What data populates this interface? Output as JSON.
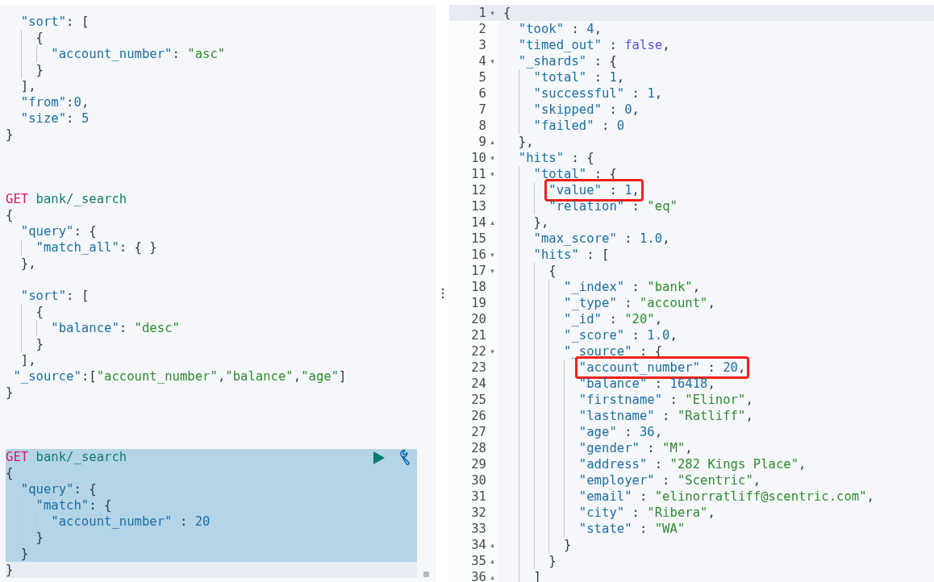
{
  "request_editor": {
    "blocks": [
      {
        "selected": false,
        "lines": [
          {
            "active": false,
            "tokens": [
              {
                "kind": "key",
                "text": "  \"sort\""
              },
              {
                "kind": "punct",
                "text": ": ["
              }
            ]
          },
          {
            "active": false,
            "tokens": [
              {
                "kind": "punct",
                "text": "    {"
              }
            ]
          },
          {
            "active": false,
            "tokens": [
              {
                "kind": "key",
                "text": "      \"account_number\""
              },
              {
                "kind": "punct",
                "text": ": "
              },
              {
                "kind": "string",
                "text": "\"asc\""
              }
            ]
          },
          {
            "active": false,
            "tokens": [
              {
                "kind": "punct",
                "text": "    }"
              }
            ]
          },
          {
            "active": false,
            "tokens": [
              {
                "kind": "punct",
                "text": "  ],"
              }
            ]
          },
          {
            "active": false,
            "tokens": [
              {
                "kind": "key",
                "text": "  \"from\""
              },
              {
                "kind": "punct",
                "text": ":"
              },
              {
                "kind": "number",
                "text": "0"
              },
              {
                "kind": "punct",
                "text": ","
              }
            ]
          },
          {
            "active": false,
            "tokens": [
              {
                "kind": "key",
                "text": "  \"size\""
              },
              {
                "kind": "punct",
                "text": ": "
              },
              {
                "kind": "number",
                "text": "5"
              }
            ]
          },
          {
            "active": false,
            "tokens": [
              {
                "kind": "punct",
                "text": "}"
              }
            ]
          }
        ]
      },
      {
        "selected": false,
        "lines": [
          {
            "active": false,
            "tokens": [
              {
                "kind": "method",
                "text": "GET"
              },
              {
                "kind": "url",
                "text": " bank/_search"
              }
            ]
          },
          {
            "active": false,
            "tokens": [
              {
                "kind": "punct",
                "text": "{"
              }
            ]
          },
          {
            "active": false,
            "tokens": [
              {
                "kind": "key",
                "text": "  \"query\""
              },
              {
                "kind": "punct",
                "text": ": {"
              }
            ]
          },
          {
            "active": false,
            "tokens": [
              {
                "kind": "key",
                "text": "    \"match_all\""
              },
              {
                "kind": "punct",
                "text": ": { }"
              }
            ]
          },
          {
            "active": false,
            "tokens": [
              {
                "kind": "punct",
                "text": "  },"
              }
            ]
          },
          {
            "kind": "blank"
          },
          {
            "active": false,
            "tokens": [
              {
                "kind": "key",
                "text": "  \"sort\""
              },
              {
                "kind": "punct",
                "text": ": ["
              }
            ]
          },
          {
            "active": false,
            "tokens": [
              {
                "kind": "punct",
                "text": "    {"
              }
            ]
          },
          {
            "active": false,
            "tokens": [
              {
                "kind": "key",
                "text": "      \"balance\""
              },
              {
                "kind": "punct",
                "text": ": "
              },
              {
                "kind": "string",
                "text": "\"desc\""
              }
            ]
          },
          {
            "active": false,
            "tokens": [
              {
                "kind": "punct",
                "text": "    }"
              }
            ]
          },
          {
            "active": false,
            "tokens": [
              {
                "kind": "punct",
                "text": "  ],"
              }
            ]
          },
          {
            "active": false,
            "tokens": [
              {
                "kind": "key",
                "text": " \"_source\""
              },
              {
                "kind": "punct",
                "text": ":["
              },
              {
                "kind": "string",
                "text": "\"account_number\""
              },
              {
                "kind": "punct",
                "text": ","
              },
              {
                "kind": "string",
                "text": "\"balance\""
              },
              {
                "kind": "punct",
                "text": ","
              },
              {
                "kind": "string",
                "text": "\"age\""
              },
              {
                "kind": "punct",
                "text": "]"
              }
            ]
          },
          {
            "active": false,
            "tokens": [
              {
                "kind": "punct",
                "text": "}"
              }
            ]
          }
        ]
      },
      {
        "selected": true,
        "lines": [
          {
            "active": false,
            "tokens": [
              {
                "kind": "method",
                "text": "GET"
              },
              {
                "kind": "url",
                "text": " bank/_search"
              }
            ]
          },
          {
            "active": false,
            "tokens": [
              {
                "kind": "punct",
                "text": "{"
              }
            ]
          },
          {
            "active": false,
            "tokens": [
              {
                "kind": "key",
                "text": "  \"query\""
              },
              {
                "kind": "punct",
                "text": ": {"
              }
            ]
          },
          {
            "active": false,
            "tokens": [
              {
                "kind": "key",
                "text": "    \"match\""
              },
              {
                "kind": "punct",
                "text": ": {"
              }
            ]
          },
          {
            "active": false,
            "tokens": [
              {
                "kind": "key",
                "text": "      \"account_number\""
              },
              {
                "kind": "punct",
                "text": " : "
              },
              {
                "kind": "number",
                "text": "20"
              }
            ]
          },
          {
            "active": false,
            "tokens": [
              {
                "kind": "punct",
                "text": "    }"
              }
            ]
          },
          {
            "active": false,
            "tokens": [
              {
                "kind": "punct",
                "text": "  }"
              }
            ]
          },
          {
            "active": true,
            "tokens": [
              {
                "kind": "punct",
                "text": "}"
              }
            ]
          }
        ]
      }
    ]
  },
  "response_viewer": {
    "lines": [
      {
        "number": "1",
        "fold": "▾",
        "active": true,
        "boxed": false,
        "tokens": [
          {
            "kind": "punct",
            "text": "{"
          }
        ]
      },
      {
        "number": "2",
        "active": false,
        "boxed": false,
        "tokens": [
          {
            "kind": "key",
            "text": "  \"took\""
          },
          {
            "kind": "punct",
            "text": " : "
          },
          {
            "kind": "number",
            "text": "4"
          },
          {
            "kind": "punct",
            "text": ","
          }
        ]
      },
      {
        "number": "3",
        "active": false,
        "boxed": false,
        "tokens": [
          {
            "kind": "key",
            "text": "  \"timed_out\""
          },
          {
            "kind": "punct",
            "text": " : "
          },
          {
            "kind": "boolean",
            "text": "false"
          },
          {
            "kind": "punct",
            "text": ","
          }
        ]
      },
      {
        "number": "4",
        "fold": "▾",
        "active": false,
        "boxed": false,
        "tokens": [
          {
            "kind": "key",
            "text": "  \"_shards\""
          },
          {
            "kind": "punct",
            "text": " : {"
          }
        ]
      },
      {
        "number": "5",
        "active": false,
        "boxed": false,
        "tokens": [
          {
            "kind": "key",
            "text": "    \"total\""
          },
          {
            "kind": "punct",
            "text": " : "
          },
          {
            "kind": "number",
            "text": "1"
          },
          {
            "kind": "punct",
            "text": ","
          }
        ]
      },
      {
        "number": "6",
        "active": false,
        "boxed": false,
        "tokens": [
          {
            "kind": "key",
            "text": "    \"successful\""
          },
          {
            "kind": "punct",
            "text": " : "
          },
          {
            "kind": "number",
            "text": "1"
          },
          {
            "kind": "punct",
            "text": ","
          }
        ]
      },
      {
        "number": "7",
        "active": false,
        "boxed": false,
        "tokens": [
          {
            "kind": "key",
            "text": "    \"skipped\""
          },
          {
            "kind": "punct",
            "text": " : "
          },
          {
            "kind": "number",
            "text": "0"
          },
          {
            "kind": "punct",
            "text": ","
          }
        ]
      },
      {
        "number": "8",
        "active": false,
        "boxed": false,
        "tokens": [
          {
            "kind": "key",
            "text": "    \"failed\""
          },
          {
            "kind": "punct",
            "text": " : "
          },
          {
            "kind": "number",
            "text": "0"
          }
        ]
      },
      {
        "number": "9",
        "fold": "▴",
        "active": false,
        "boxed": false,
        "tokens": [
          {
            "kind": "punct",
            "text": "  },"
          }
        ]
      },
      {
        "number": "10",
        "fold": "▾",
        "active": false,
        "boxed": false,
        "tokens": [
          {
            "kind": "key",
            "text": "  \"hits\""
          },
          {
            "kind": "punct",
            "text": " : {"
          }
        ]
      },
      {
        "number": "11",
        "fold": "▾",
        "active": false,
        "boxed": false,
        "tokens": [
          {
            "kind": "key",
            "text": "    \"total\""
          },
          {
            "kind": "punct",
            "text": " : {"
          }
        ]
      },
      {
        "number": "12",
        "active": false,
        "boxed": true,
        "tokens": [
          {
            "kind": "key",
            "text": "      \"value\""
          },
          {
            "kind": "punct",
            "text": " : "
          },
          {
            "kind": "number",
            "text": "1"
          },
          {
            "kind": "punct",
            "text": ","
          }
        ]
      },
      {
        "number": "13",
        "active": false,
        "boxed": false,
        "tokens": [
          {
            "kind": "key",
            "text": "      \"relation\""
          },
          {
            "kind": "punct",
            "text": " : "
          },
          {
            "kind": "string",
            "text": "\"eq\""
          }
        ]
      },
      {
        "number": "14",
        "fold": "▴",
        "active": false,
        "boxed": false,
        "tokens": [
          {
            "kind": "punct",
            "text": "    },"
          }
        ]
      },
      {
        "number": "15",
        "active": false,
        "boxed": false,
        "tokens": [
          {
            "kind": "key",
            "text": "    \"max_score\""
          },
          {
            "kind": "punct",
            "text": " : "
          },
          {
            "kind": "number",
            "text": "1.0"
          },
          {
            "kind": "punct",
            "text": ","
          }
        ]
      },
      {
        "number": "16",
        "fold": "▾",
        "active": false,
        "boxed": false,
        "tokens": [
          {
            "kind": "key",
            "text": "    \"hits\""
          },
          {
            "kind": "punct",
            "text": " : ["
          }
        ]
      },
      {
        "number": "17",
        "fold": "▾",
        "active": false,
        "boxed": false,
        "tokens": [
          {
            "kind": "punct",
            "text": "      {"
          }
        ]
      },
      {
        "number": "18",
        "active": false,
        "boxed": false,
        "tokens": [
          {
            "kind": "key",
            "text": "        \"_index\""
          },
          {
            "kind": "punct",
            "text": " : "
          },
          {
            "kind": "string",
            "text": "\"bank\""
          },
          {
            "kind": "punct",
            "text": ","
          }
        ]
      },
      {
        "number": "19",
        "active": false,
        "boxed": false,
        "tokens": [
          {
            "kind": "key",
            "text": "        \"_type\""
          },
          {
            "kind": "punct",
            "text": " : "
          },
          {
            "kind": "string",
            "text": "\"account\""
          },
          {
            "kind": "punct",
            "text": ","
          }
        ]
      },
      {
        "number": "20",
        "active": false,
        "boxed": false,
        "tokens": [
          {
            "kind": "key",
            "text": "        \"_id\""
          },
          {
            "kind": "punct",
            "text": " : "
          },
          {
            "kind": "string",
            "text": "\"20\""
          },
          {
            "kind": "punct",
            "text": ","
          }
        ]
      },
      {
        "number": "21",
        "active": false,
        "boxed": false,
        "tokens": [
          {
            "kind": "key",
            "text": "        \"_score\""
          },
          {
            "kind": "punct",
            "text": " : "
          },
          {
            "kind": "number",
            "text": "1.0"
          },
          {
            "kind": "punct",
            "text": ","
          }
        ]
      },
      {
        "number": "22",
        "fold": "▾",
        "active": false,
        "boxed": false,
        "tokens": [
          {
            "kind": "key",
            "text": "        \"_source\""
          },
          {
            "kind": "punct",
            "text": " : {"
          }
        ]
      },
      {
        "number": "23",
        "active": false,
        "boxed": true,
        "tokens": [
          {
            "kind": "key",
            "text": "          \"account_number\""
          },
          {
            "kind": "punct",
            "text": " : "
          },
          {
            "kind": "number",
            "text": "20"
          },
          {
            "kind": "punct",
            "text": ","
          }
        ]
      },
      {
        "number": "24",
        "active": false,
        "boxed": false,
        "tokens": [
          {
            "kind": "key",
            "text": "          \"balance\""
          },
          {
            "kind": "punct",
            "text": " : "
          },
          {
            "kind": "number",
            "text": "16418"
          },
          {
            "kind": "punct",
            "text": ","
          }
        ]
      },
      {
        "number": "25",
        "active": false,
        "boxed": false,
        "tokens": [
          {
            "kind": "key",
            "text": "          \"firstname\""
          },
          {
            "kind": "punct",
            "text": " : "
          },
          {
            "kind": "string",
            "text": "\"Elinor\""
          },
          {
            "kind": "punct",
            "text": ","
          }
        ]
      },
      {
        "number": "26",
        "active": false,
        "boxed": false,
        "tokens": [
          {
            "kind": "key",
            "text": "          \"lastname\""
          },
          {
            "kind": "punct",
            "text": " : "
          },
          {
            "kind": "string",
            "text": "\"Ratliff\""
          },
          {
            "kind": "punct",
            "text": ","
          }
        ]
      },
      {
        "number": "27",
        "active": false,
        "boxed": false,
        "tokens": [
          {
            "kind": "key",
            "text": "          \"age\""
          },
          {
            "kind": "punct",
            "text": " : "
          },
          {
            "kind": "number",
            "text": "36"
          },
          {
            "kind": "punct",
            "text": ","
          }
        ]
      },
      {
        "number": "28",
        "active": false,
        "boxed": false,
        "tokens": [
          {
            "kind": "key",
            "text": "          \"gender\""
          },
          {
            "kind": "punct",
            "text": " : "
          },
          {
            "kind": "string",
            "text": "\"M\""
          },
          {
            "kind": "punct",
            "text": ","
          }
        ]
      },
      {
        "number": "29",
        "active": false,
        "boxed": false,
        "tokens": [
          {
            "kind": "key",
            "text": "          \"address\""
          },
          {
            "kind": "punct",
            "text": " : "
          },
          {
            "kind": "string",
            "text": "\"282 Kings Place\""
          },
          {
            "kind": "punct",
            "text": ","
          }
        ]
      },
      {
        "number": "30",
        "active": false,
        "boxed": false,
        "tokens": [
          {
            "kind": "key",
            "text": "          \"employer\""
          },
          {
            "kind": "punct",
            "text": " : "
          },
          {
            "kind": "string",
            "text": "\"Scentric\""
          },
          {
            "kind": "punct",
            "text": ","
          }
        ]
      },
      {
        "number": "31",
        "active": false,
        "boxed": false,
        "tokens": [
          {
            "kind": "key",
            "text": "          \"email\""
          },
          {
            "kind": "punct",
            "text": " : "
          },
          {
            "kind": "string",
            "text": "\"elinorratliff@scentric.com\""
          },
          {
            "kind": "punct",
            "text": ","
          }
        ]
      },
      {
        "number": "32",
        "active": false,
        "boxed": false,
        "tokens": [
          {
            "kind": "key",
            "text": "          \"city\""
          },
          {
            "kind": "punct",
            "text": " : "
          },
          {
            "kind": "string",
            "text": "\"Ribera\""
          },
          {
            "kind": "punct",
            "text": ","
          }
        ]
      },
      {
        "number": "33",
        "active": false,
        "boxed": false,
        "tokens": [
          {
            "kind": "key",
            "text": "          \"state\""
          },
          {
            "kind": "punct",
            "text": " : "
          },
          {
            "kind": "string",
            "text": "\"WA\""
          }
        ]
      },
      {
        "number": "34",
        "fold": "▴",
        "active": false,
        "boxed": false,
        "tokens": [
          {
            "kind": "punct",
            "text": "        }"
          }
        ]
      },
      {
        "number": "35",
        "fold": "▴",
        "active": false,
        "boxed": false,
        "tokens": [
          {
            "kind": "punct",
            "text": "      }"
          }
        ]
      },
      {
        "number": "36",
        "fold": "▴",
        "active": false,
        "boxed": false,
        "tokens": [
          {
            "kind": "punct",
            "text": "    ]"
          }
        ]
      }
    ]
  }
}
